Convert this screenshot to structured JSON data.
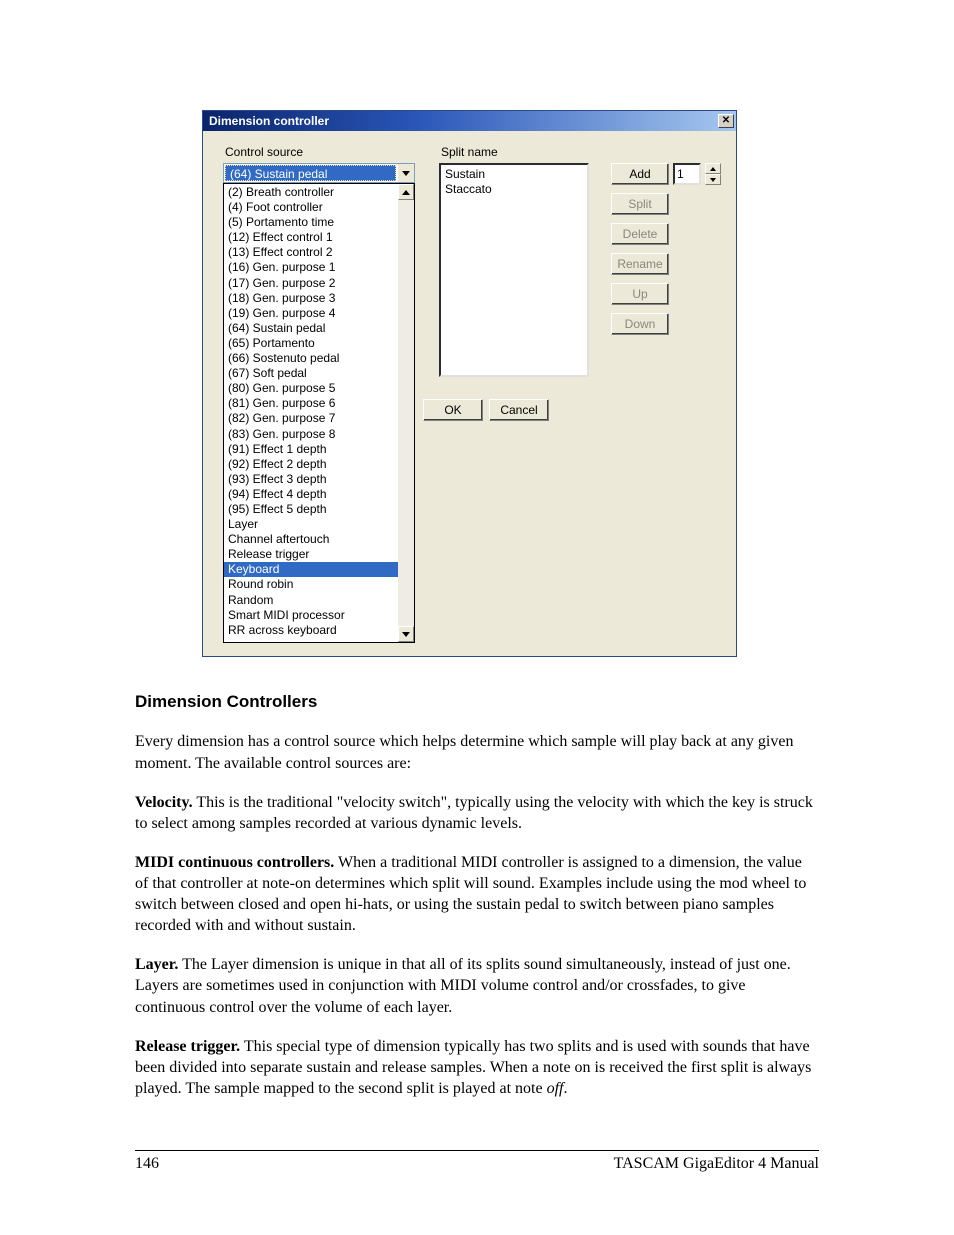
{
  "dialog": {
    "title": "Dimension controller",
    "control_source_label": "Control source",
    "split_name_label": "Split name",
    "combo_selected": "(64) Sustain pedal",
    "dropdown_items": [
      "(2) Breath controller",
      "(4) Foot controller",
      "(5) Portamento time",
      "(12) Effect control 1",
      "(13) Effect control 2",
      "(16) Gen. purpose 1",
      "(17) Gen. purpose 2",
      "(18) Gen. purpose 3",
      "(19) Gen. purpose 4",
      "(64) Sustain pedal",
      "(65) Portamento",
      "(66) Sostenuto pedal",
      "(67) Soft pedal",
      "(80) Gen. purpose 5",
      "(81) Gen. purpose 6",
      "(82) Gen. purpose 7",
      "(83) Gen. purpose 8",
      "(91) Effect 1 depth",
      "(92) Effect 2 depth",
      "(93) Effect 3 depth",
      "(94) Effect 4 depth",
      "(95) Effect 5 depth",
      "Layer",
      "Channel aftertouch",
      "Release trigger",
      "Keyboard",
      "Round robin",
      "Random",
      "Smart MIDI processor",
      "RR across keyboard"
    ],
    "dropdown_highlight": "Keyboard",
    "split_items": [
      "Sustain",
      "Staccato"
    ],
    "spin_value": "1",
    "buttons": {
      "add": "Add",
      "split": "Split",
      "delete": "Delete",
      "rename": "Rename",
      "up": "Up",
      "down": "Down",
      "ok": "OK",
      "cancel": "Cancel"
    }
  },
  "doc": {
    "heading": "Dimension Controllers",
    "p_intro": "Every dimension has a control source which helps determine which sample will play back at any given moment.  The available control sources are:",
    "velocity_label": "Velocity.",
    "velocity_body": "  This is the traditional \"velocity switch\", typically using the velocity with which the key is struck to select among samples recorded at various dynamic levels.",
    "midi_label": "MIDI continuous controllers.",
    "midi_body": "  When a traditional MIDI controller is assigned to a dimension, the value of that controller at note-on determines which split will sound.  Examples include using the mod wheel to switch between closed and open hi-hats, or using the sustain pedal to switch between piano samples recorded with and without sustain.",
    "layer_label": "Layer.",
    "layer_body": "  The Layer dimension is unique in that all of its splits sound simultaneously, instead of just one.  Layers are sometimes used in conjunction with MIDI volume control and/or crossfades, to give continuous control over the volume of each layer.",
    "release_label": "Release trigger.",
    "release_body_1": "  This special type of dimension typically has two splits and is used with sounds that have been divided into separate sustain and release samples.  When a note on is received the first split is always played.  The sample mapped to the second split is played at note ",
    "release_off": "off",
    "release_body_2": "."
  },
  "footer": {
    "page": "146",
    "manual": "TASCAM GigaEditor 4 Manual"
  }
}
